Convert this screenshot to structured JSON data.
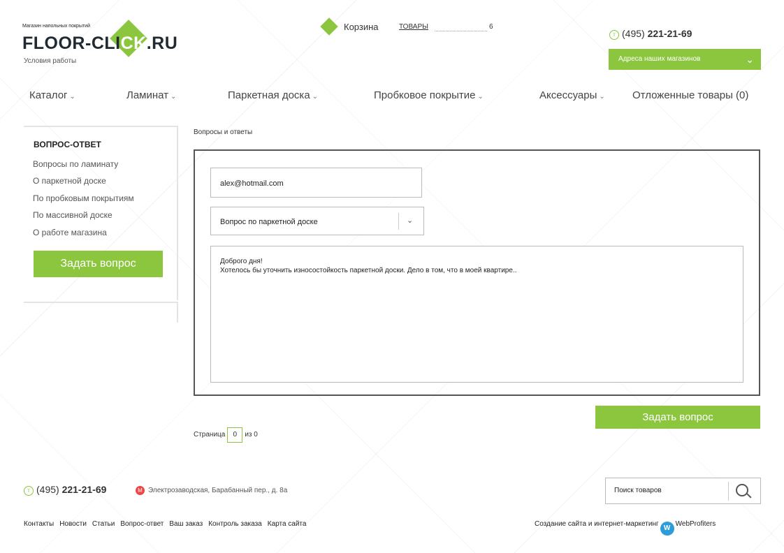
{
  "header": {
    "logo_tagline": "Магазин напольных покрытий",
    "logo_part1": "FLOOR-CLI",
    "logo_part2": "CK",
    "logo_part3": ".RU",
    "logo_sub": "Условия работы",
    "cart_label": "Корзина",
    "cart_goods_label": "ТОВАРЫ",
    "cart_count": "6",
    "phone_prefix": "(495)",
    "phone_number": "221-21-69",
    "stores_button": "Адреса наших магазинов"
  },
  "nav": {
    "items": [
      {
        "label": "Каталог"
      },
      {
        "label": "Ламинат"
      },
      {
        "label": "Паркетная доска"
      },
      {
        "label": "Пробковое покрытие"
      },
      {
        "label": "Аксессуары"
      },
      {
        "label": "Отложенные товары (0)"
      }
    ]
  },
  "sidebar": {
    "title": "ВОПРОС-ОТВЕТ",
    "links": [
      "Вопросы по ламинату",
      "О паркетной доске",
      "По пробковым покрытиям",
      "По массивной доске",
      "О работе магазина"
    ],
    "ask_button": "Задать вопрос"
  },
  "main": {
    "breadcrumb": "Вопросы и ответы",
    "email_value": "alex@hotmail.com",
    "topic_selected": "Вопрос по паркетной доске",
    "message_line1": "Доброго дня!",
    "message_line2": "Хотелось бы уточнить износостойкость паркетной доски. Дело в том, что в моей квартире..",
    "submit_button": "Задать вопрос",
    "pager_label": "Страница",
    "pager_current": "0",
    "pager_of": "из 0"
  },
  "footer": {
    "phone_prefix": "(495)",
    "phone_number": "221-21-69",
    "address": "Электрозаводская, Барабанный пер., д. 8а",
    "search_placeholder": "Поиск товаров",
    "links": [
      "Контакты",
      "Новости",
      "Статьи",
      "Вопрос-ответ",
      "Ваш заказ",
      "Контроль заказа",
      "Карта сайта"
    ],
    "credit_text": "Создание сайта и интернет-маркетинг",
    "credit_brand": "WebProfiters"
  },
  "colors": {
    "accent": "#8cc63f",
    "border_dark": "#555555"
  }
}
